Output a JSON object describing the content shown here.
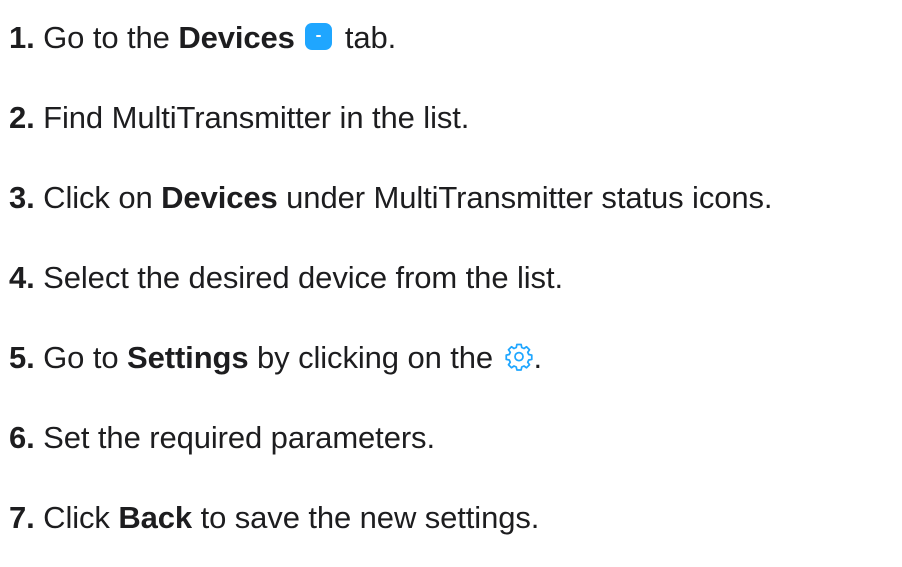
{
  "steps": [
    {
      "num": "1.",
      "a": "Go to the ",
      "b": "Devices",
      "c": " tab."
    },
    {
      "num": "2.",
      "a": "Find MultiTransmitter in the list."
    },
    {
      "num": "3.",
      "a": "Click on ",
      "b": "Devices",
      "c": " under MultiTransmitter status icons."
    },
    {
      "num": "4.",
      "a": "Select the desired device from the list."
    },
    {
      "num": "5.",
      "a": "Go to ",
      "b": "Settings",
      "c": " by clicking on the ",
      "d": "."
    },
    {
      "num": "6.",
      "a": "Set the required parameters."
    },
    {
      "num": "7.",
      "a": "Click ",
      "b": "Back",
      "c": " to save the new settings."
    }
  ],
  "colors": {
    "accent": "#1fa6ff",
    "text": "#1d1d1f"
  },
  "icons": {
    "devices_tab": "devices-tab-icon",
    "settings": "gear-icon"
  }
}
